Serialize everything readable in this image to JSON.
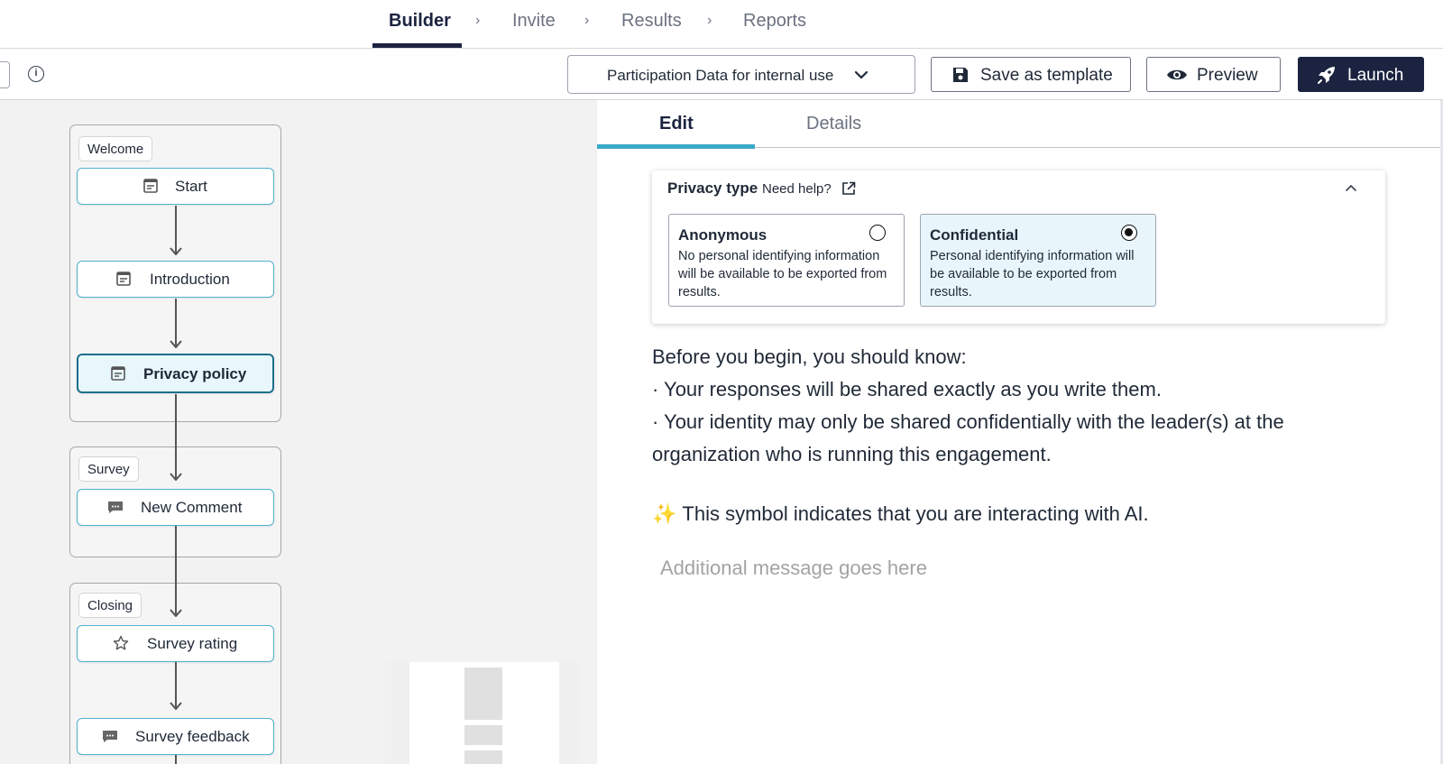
{
  "stepper": {
    "steps": [
      "Builder",
      "Invite",
      "Results",
      "Reports"
    ],
    "active": "Builder",
    "separator": "›"
  },
  "toolbar": {
    "info_icon": "info-icon",
    "dropdown_value": "Participation Data for internal use",
    "save_template_label": "Save as template",
    "preview_label": "Preview",
    "launch_label": "Launch"
  },
  "canvas": {
    "groups": [
      {
        "tag": "Welcome",
        "nodes": [
          {
            "label": "Start",
            "icon": "form-icon"
          },
          {
            "label": "Introduction",
            "icon": "form-icon"
          },
          {
            "label": "Privacy policy",
            "icon": "form-icon",
            "selected": true
          }
        ]
      },
      {
        "tag": "Survey",
        "nodes": [
          {
            "label": "New Comment",
            "icon": "comment-icon"
          }
        ]
      },
      {
        "tag": "Closing",
        "nodes": [
          {
            "label": "Survey rating",
            "icon": "star-icon"
          },
          {
            "label": "Survey feedback",
            "icon": "comment-icon"
          }
        ]
      }
    ]
  },
  "panel": {
    "tabs": [
      "Edit",
      "Details"
    ],
    "active_tab": "Edit",
    "privacy": {
      "title": "Privacy type",
      "help_label": "Need help?",
      "options": [
        {
          "title": "Anonymous",
          "description": "No personal identifying information will be available to be exported from results.",
          "checked": false
        },
        {
          "title": "Confidential",
          "description": "Personal identifying information will be available to be exported from results.",
          "checked": true
        }
      ]
    },
    "message": {
      "intro": "Before you begin, you should know:",
      "bullet1": "· Your responses will be shared exactly as you write them.",
      "bullet2": "· Your identity may only be shared confidentially with the leader(s) at the organization who is running this engagement.",
      "ai_spark": "✨",
      "ai_note": "This symbol indicates that you are interacting with AI.",
      "additional_placeholder": "Additional message goes here"
    }
  },
  "colors": {
    "navy": "#1b2340",
    "accent": "#3aa9c7",
    "node_border": "#4fb3cf"
  }
}
